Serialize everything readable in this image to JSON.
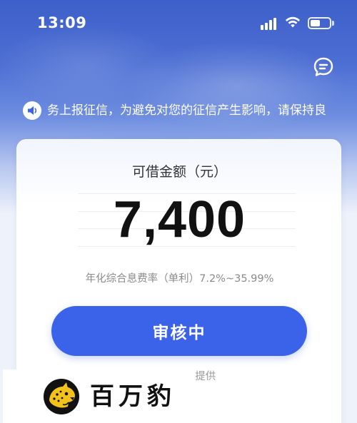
{
  "status_bar": {
    "time": "13:09",
    "battery_level": 0.5
  },
  "notice": {
    "text": "务上报征信，为避免对您的征信产生影响，请保持良"
  },
  "card": {
    "label": "可借金额（元）",
    "amount": "7,400",
    "rate": "年化综合息费率（单利）7.2%~35.99%",
    "button_label": "审核中",
    "provider": "由放款机构提供"
  },
  "watermark": {
    "text": "百万豹"
  },
  "colors": {
    "accent": "#3a63ea",
    "header": "#4d6fd4"
  },
  "icons": {
    "chat": "chat-bubble-icon",
    "notice": "speaker-icon",
    "logo": "leopard-icon"
  }
}
